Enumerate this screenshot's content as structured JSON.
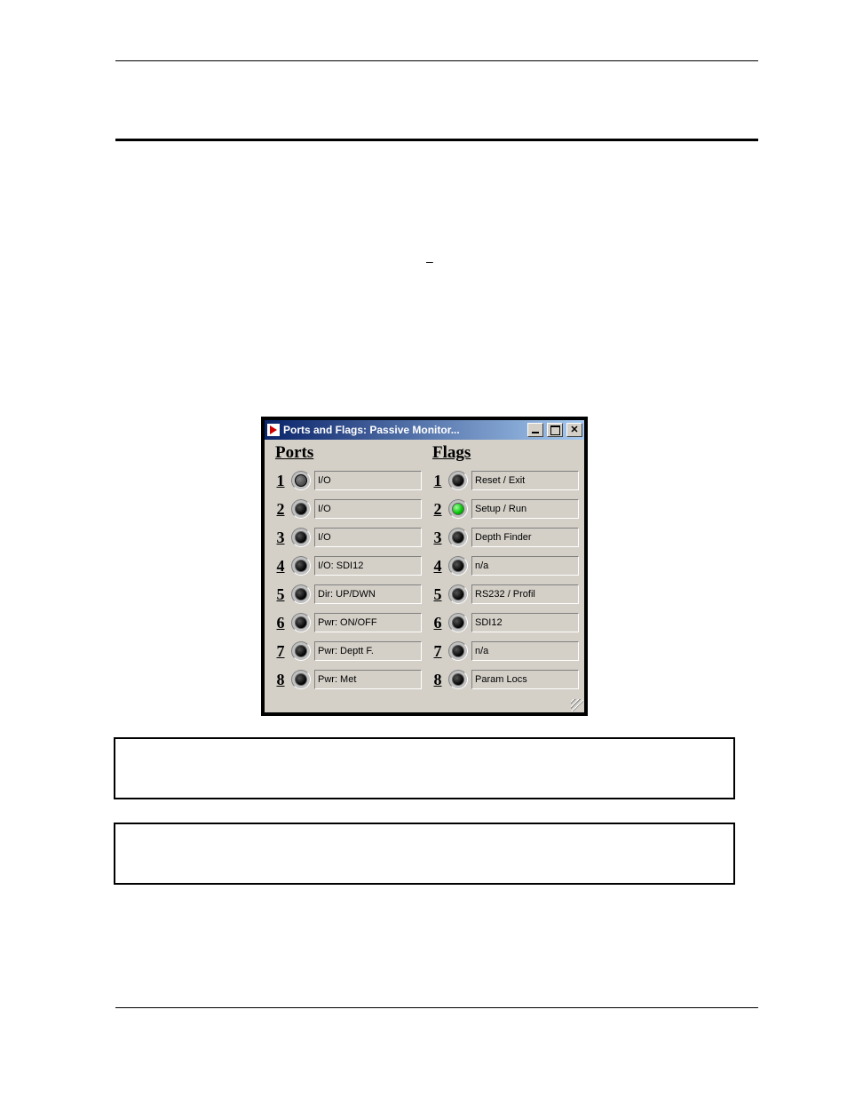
{
  "window": {
    "title": "Ports and Flags: Passive Monitor..."
  },
  "ports": {
    "header": "Ports",
    "rows": [
      {
        "num": "1",
        "label": "I/O",
        "state": "dim"
      },
      {
        "num": "2",
        "label": "I/O",
        "state": "off"
      },
      {
        "num": "3",
        "label": "I/O",
        "state": "off"
      },
      {
        "num": "4",
        "label": "I/O: SDI12",
        "state": "off"
      },
      {
        "num": "5",
        "label": "Dir: UP/DWN",
        "state": "off"
      },
      {
        "num": "6",
        "label": "Pwr: ON/OFF",
        "state": "off"
      },
      {
        "num": "7",
        "label": "Pwr: Deptt F.",
        "state": "off"
      },
      {
        "num": "8",
        "label": "Pwr: Met",
        "state": "off"
      }
    ]
  },
  "flags": {
    "header": "Flags",
    "rows": [
      {
        "num": "1",
        "label": "Reset / Exit",
        "state": "off"
      },
      {
        "num": "2",
        "label": "Setup / Run",
        "state": "on"
      },
      {
        "num": "3",
        "label": "Depth Finder",
        "state": "off"
      },
      {
        "num": "4",
        "label": "n/a",
        "state": "off"
      },
      {
        "num": "5",
        "label": "RS232 / Profil",
        "state": "off"
      },
      {
        "num": "6",
        "label": "SDI12",
        "state": "off"
      },
      {
        "num": "7",
        "label": "n/a",
        "state": "off"
      },
      {
        "num": "8",
        "label": "Param Locs",
        "state": "off"
      }
    ]
  },
  "page_dash": "–"
}
